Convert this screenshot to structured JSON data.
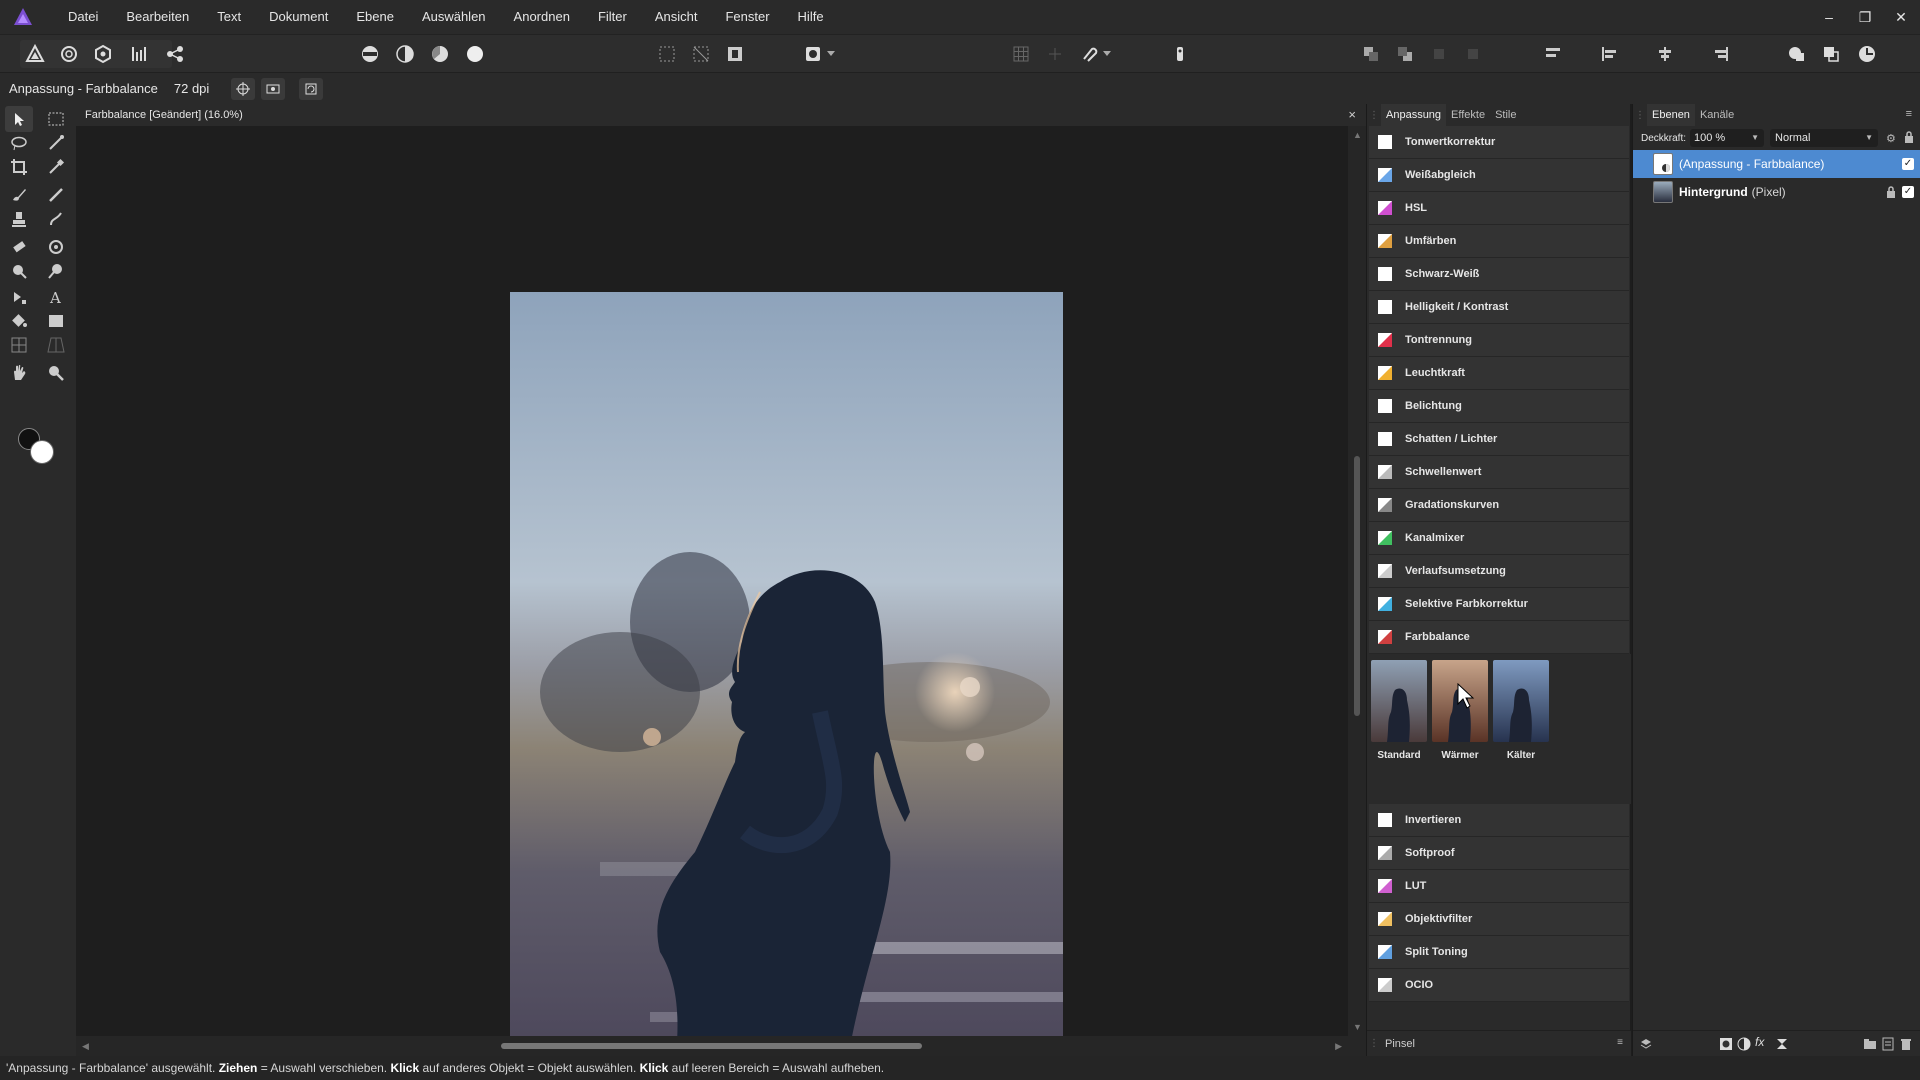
{
  "app": {
    "name": "Affinity Photo",
    "accent": "#7b4fd1"
  },
  "menu": [
    "Datei",
    "Bearbeiten",
    "Text",
    "Dokument",
    "Ebene",
    "Auswählen",
    "Anordnen",
    "Filter",
    "Ansicht",
    "Fenster",
    "Hilfe"
  ],
  "window_controls": {
    "minimize": "–",
    "restore": "❐",
    "close": "✕"
  },
  "context": {
    "title": "Anpassung - Farbbalance",
    "dpi": "72 dpi"
  },
  "document": {
    "tab_title": "Farbbalance [Geändert] (16.0%)",
    "close": "×"
  },
  "adjust_panel": {
    "tabs": [
      "Anpassung",
      "Effekte",
      "Stile"
    ],
    "items": [
      {
        "label": "Tonwertkorrektur",
        "icon": "levels-icon",
        "color": "#ffffff"
      },
      {
        "label": "Weißabgleich",
        "icon": "white-balance-icon",
        "color": "#6aa6e8"
      },
      {
        "label": "HSL",
        "icon": "hsl-icon",
        "color": "#d04fd0"
      },
      {
        "label": "Umfärben",
        "icon": "recolor-icon",
        "color": "#e0a040"
      },
      {
        "label": "Schwarz-Weiß",
        "icon": "black-white-icon",
        "color": "#ffffff"
      },
      {
        "label": "Helligkeit / Kontrast",
        "icon": "brightness-contrast-icon",
        "color": "#ffffff"
      },
      {
        "label": "Tontrennung",
        "icon": "posterize-icon",
        "color": "#e0304a"
      },
      {
        "label": "Leuchtkraft",
        "icon": "vibrance-icon",
        "color": "#f0b030"
      },
      {
        "label": "Belichtung",
        "icon": "exposure-icon",
        "color": "#ffffff"
      },
      {
        "label": "Schatten / Lichter",
        "icon": "shadows-highlights-icon",
        "color": "#ffffff"
      },
      {
        "label": "Schwellenwert",
        "icon": "threshold-icon",
        "color": "#bbbbbb"
      },
      {
        "label": "Gradationskurven",
        "icon": "curves-icon",
        "color": "#888888"
      },
      {
        "label": "Kanalmixer",
        "icon": "channel-mixer-icon",
        "color": "#40c060"
      },
      {
        "label": "Verlaufsumsetzung",
        "icon": "gradient-map-icon",
        "color": "#cccccc"
      },
      {
        "label": "Selektive Farbkorrektur",
        "icon": "selective-color-icon",
        "color": "#40b0e0"
      },
      {
        "label": "Farbbalance",
        "icon": "color-balance-icon",
        "color": "#d04040"
      }
    ],
    "presets": [
      {
        "label": "Standard"
      },
      {
        "label": "Wärmer"
      },
      {
        "label": "Kälter"
      }
    ],
    "items_after": [
      {
        "label": "Invertieren",
        "icon": "invert-icon",
        "color": "#ffffff"
      },
      {
        "label": "Softproof",
        "icon": "soft-proof-icon",
        "color": "#aaaaaa"
      },
      {
        "label": "LUT",
        "icon": "lut-icon",
        "color": "#d060d0"
      },
      {
        "label": "Objektivfilter",
        "icon": "lens-filter-icon",
        "color": "#f0c060"
      },
      {
        "label": "Split Toning",
        "icon": "split-toning-icon",
        "color": "#60a0e0"
      },
      {
        "label": "OCIO",
        "icon": "ocio-icon",
        "color": "#cccccc"
      }
    ],
    "bottom_label": "Pinsel"
  },
  "layers_panel": {
    "tabs": [
      "Ebenen",
      "Kanäle"
    ],
    "opacity_label": "Deckkraft:",
    "opacity_value": "100 %",
    "blend_mode": "Normal",
    "layers": [
      {
        "name": "(Anpassung - Farbbalance)",
        "type": "",
        "selected": true
      },
      {
        "name": "Hintergrund",
        "type": "(Pixel)",
        "selected": false
      }
    ]
  },
  "status": {
    "t1": "'Anpassung - Farbbalance' ausgewählt. ",
    "b1": "Ziehen",
    "t2": " = Auswahl verschieben. ",
    "b2": "Klick",
    "t3": " auf anderes Objekt = Objekt auswählen. ",
    "b3": "Klick",
    "t4": " auf leeren Bereich = Auswahl aufheben."
  }
}
